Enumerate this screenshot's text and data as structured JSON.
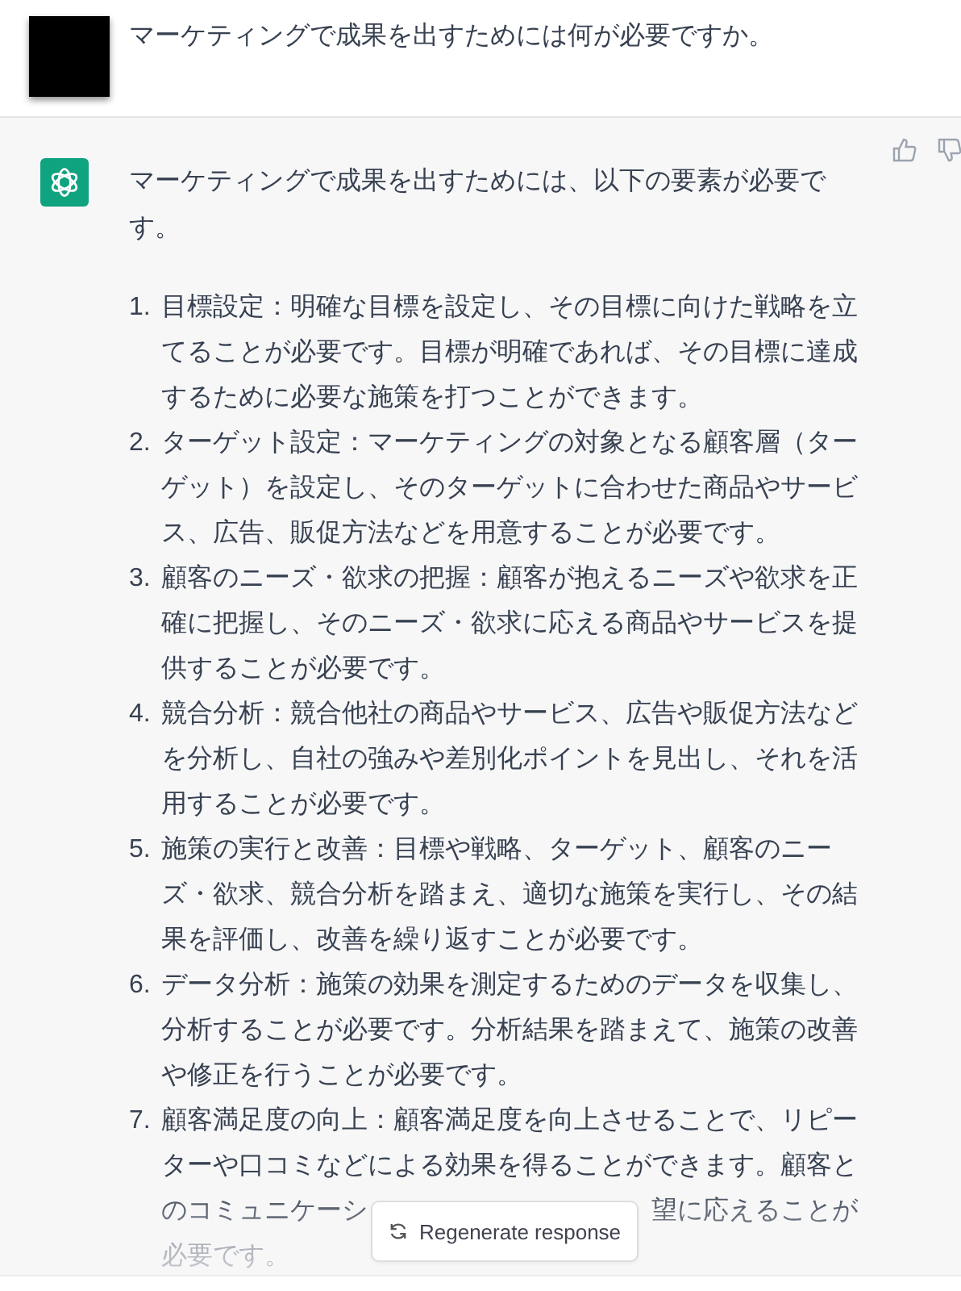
{
  "user_message": {
    "text": "マーケティングで成果を出すためには何が必要ですか。"
  },
  "assistant_message": {
    "intro": "マーケティングで成果を出すためには、以下の要素が必要です。",
    "items": [
      {
        "number": "1.",
        "text": "目標設定：明確な目標を設定し、その目標に向けた戦略を立てることが必要です。目標が明確であれば、その目標に達成するために必要な施策を打つことができます。"
      },
      {
        "number": "2.",
        "text": "ターゲット設定：マーケティングの対象となる顧客層（ターゲット）を設定し、そのターゲットに合わせた商品やサービス、広告、販促方法などを用意することが必要です。"
      },
      {
        "number": "3.",
        "text": "顧客のニーズ・欲求の把握：顧客が抱えるニーズや欲求を正確に把握し、そのニーズ・欲求に応える商品やサービスを提供することが必要です。"
      },
      {
        "number": "4.",
        "text": "競合分析：競合他社の商品やサービス、広告や販促方法などを分析し、自社の強みや差別化ポイントを見出し、それを活用することが必要です。"
      },
      {
        "number": "5.",
        "text": "施策の実行と改善：目標や戦略、ターゲット、顧客のニーズ・欲求、競合分析を踏まえ、適切な施策を実行し、その結果を評価し、改善を繰り返すことが必要です。"
      },
      {
        "number": "6.",
        "text": "データ分析：施策の効果を測定するためのデータを収集し、分析することが必要です。分析結果を踏まえて、施策の改善や修正を行うことが必要です。"
      },
      {
        "number": "7.",
        "text": "顧客満足度の向上：顧客満足度を向上させることで、リピーターや口コミなどによる効果を得ることができます。顧客と",
        "covered_line": [
          "のコミュニケーシ",
          "望に応えることが"
        ],
        "last_line": "必要です。"
      }
    ]
  },
  "regenerate_button": {
    "label": "Regenerate response"
  }
}
